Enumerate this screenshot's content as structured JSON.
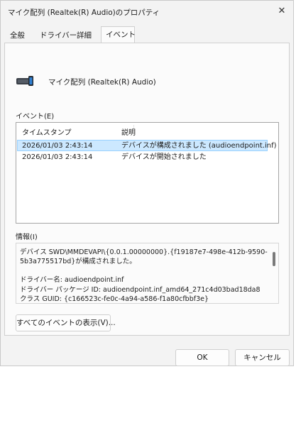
{
  "window": {
    "title": "マイク配列 (Realtek(R) Audio)のプロパティ",
    "close_glyph": "✕"
  },
  "tabs": [
    "全般",
    "ドライバー",
    "詳細",
    "イベント"
  ],
  "active_tab": "イベント",
  "device": {
    "name": "マイク配列 (Realtek(R) Audio)",
    "icon": "microphone-array-icon"
  },
  "events": {
    "label": "イベント(E)",
    "columns": [
      "タイムスタンプ",
      "説明"
    ],
    "rows": [
      {
        "timestamp": "2026/01/03 2:43:14",
        "description": "デバイスが構成されました (audioendpoint.inf)",
        "selected": true
      },
      {
        "timestamp": "2026/01/03 2:43:14",
        "description": "デバイスが開始されました",
        "selected": false
      }
    ]
  },
  "info": {
    "label": "情報(I)",
    "lines": [
      "デバイス SWD\\MMDEVAPI\\{0.0.1.00000000}.{f19187e7-498e-412b-9590-",
      "5b3a775517bd}が構成されました。",
      "",
      "ドライバー名: audioendpoint.inf",
      "ドライバー パッケージ ID: audioendpoint.inf_amd64_271c4d03bad18da8",
      "クラス GUID: {c166523c-fe0c-4a94-a586-f1a80cfbbf3e}"
    ]
  },
  "buttons": {
    "show_all_events": "すべてのイベントの表示(V)...",
    "ok": "OK",
    "cancel": "キャンセル"
  },
  "colors": {
    "selection": "#cce8ff",
    "selection_border": "#99d1ff",
    "dialog_bg": "#f3f3f3"
  }
}
